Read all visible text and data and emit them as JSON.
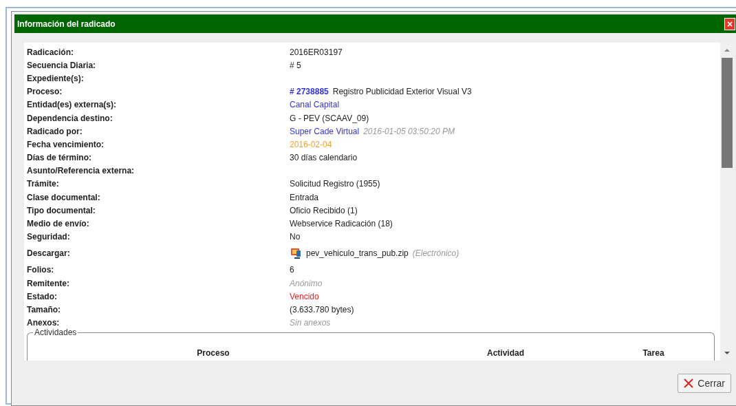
{
  "dialog": {
    "title": "Información del radicado",
    "close_icon": "×"
  },
  "fields": [
    {
      "label": "Radicación:",
      "value": [
        {
          "kind": "text",
          "text": "2016ER03197"
        }
      ]
    },
    {
      "label": "Secuencia Diaria:",
      "value": [
        {
          "kind": "text",
          "text": "# 5"
        }
      ]
    },
    {
      "label": "Expediente(s):"
    },
    {
      "label": "Proceso:",
      "value": [
        {
          "kind": "link-bold",
          "text": "# 2738885"
        },
        {
          "kind": "text",
          "text": "Registro Publicidad Exterior Visual V3"
        }
      ]
    },
    {
      "label": "Entidad(es) externa(s):",
      "value": [
        {
          "kind": "link",
          "text": "Canal Capital"
        }
      ]
    },
    {
      "label": "Dependencia destino:",
      "value": [
        {
          "kind": "text",
          "text": "G - PEV (SCAAV_09)"
        }
      ]
    },
    {
      "label": "Radicado por:",
      "value": [
        {
          "kind": "link",
          "text": "Super Cade Virtual"
        },
        {
          "kind": "muted",
          "text": "2016-01-05 03:50:20 PM"
        }
      ]
    },
    {
      "label": "Fecha vencimiento:",
      "value": [
        {
          "kind": "date",
          "text": "2016-02-04"
        }
      ]
    },
    {
      "label": "Días de término:",
      "value": [
        {
          "kind": "text",
          "text": "30 días calendario"
        }
      ]
    },
    {
      "label": "Asunto/Referencia externa:"
    },
    {
      "label": "Trámite:",
      "value": [
        {
          "kind": "text",
          "text": "Solicitud Registro (1955)"
        }
      ]
    },
    {
      "label": "Clase documental:",
      "value": [
        {
          "kind": "text",
          "text": "Entrada"
        }
      ]
    },
    {
      "label": "Tipo documental:",
      "value": [
        {
          "kind": "text",
          "text": "Oficio Recibido (1)"
        }
      ]
    },
    {
      "label": "Medio de envío:",
      "value": [
        {
          "kind": "text",
          "text": "Webservice Radicación (18)"
        }
      ]
    },
    {
      "label": "Seguridad:",
      "value": [
        {
          "kind": "text",
          "text": "No"
        }
      ]
    },
    {
      "label": "Descargar:",
      "value": [
        {
          "kind": "file",
          "text": "pev_vehiculo_trans_pub.zip"
        },
        {
          "kind": "muted",
          "text": "(Electrónico)"
        }
      ]
    },
    {
      "label": "Folios:",
      "value": [
        {
          "kind": "text",
          "text": "6"
        }
      ]
    },
    {
      "label": "Remitente:",
      "value": [
        {
          "kind": "muted",
          "text": "Anónimo"
        }
      ]
    },
    {
      "label": "Estado:",
      "value": [
        {
          "kind": "status",
          "text": "Vencido"
        }
      ]
    },
    {
      "label": "Tamaño:",
      "value": [
        {
          "kind": "text",
          "text": "(3.633.780 bytes)"
        }
      ]
    },
    {
      "label": "Anexos:",
      "value": [
        {
          "kind": "muted",
          "text": "Sin anexos"
        }
      ]
    }
  ],
  "activities": {
    "legend": "Actividades",
    "columns": [
      "Proceso",
      "Actividad",
      "Tarea"
    ]
  },
  "buttons": [
    {
      "label": "Cerrar"
    }
  ]
}
